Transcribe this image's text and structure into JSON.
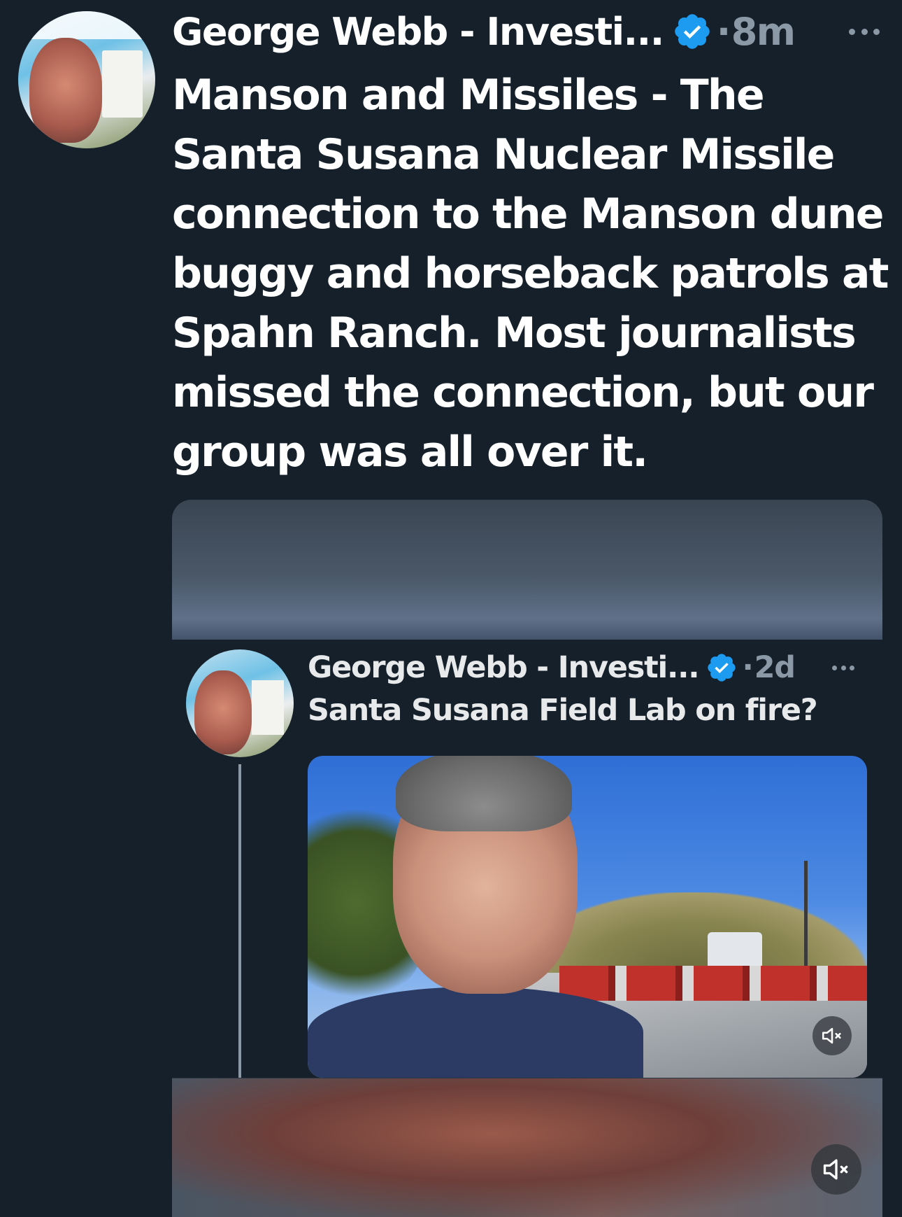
{
  "tweet": {
    "author_name": "George Webb - Investi...",
    "verified": true,
    "separator": "·",
    "timestamp": "8m",
    "text": "Manson and Missiles - The Santa Susana Nuclear Missile connection to the Manson dune buggy and horseback patrols at Spahn Ranch. Most journalists missed the connection, but our group was all over it.",
    "avatar_icon": "profile-photo",
    "more_icon": "more-horizontal-icon"
  },
  "embedded_post": {
    "author_name": "George Webb - Investi...",
    "verified": true,
    "separator": "·",
    "timestamp": "2d",
    "text": "Santa Susana Field Lab on fire?",
    "video_mute_icon": "volume-muted-icon"
  },
  "media": {
    "mute_icon": "volume-muted-icon"
  },
  "colors": {
    "background": "#15202b",
    "verified_badge": "#1d9bf0",
    "secondary_text": "#8b98a5"
  }
}
